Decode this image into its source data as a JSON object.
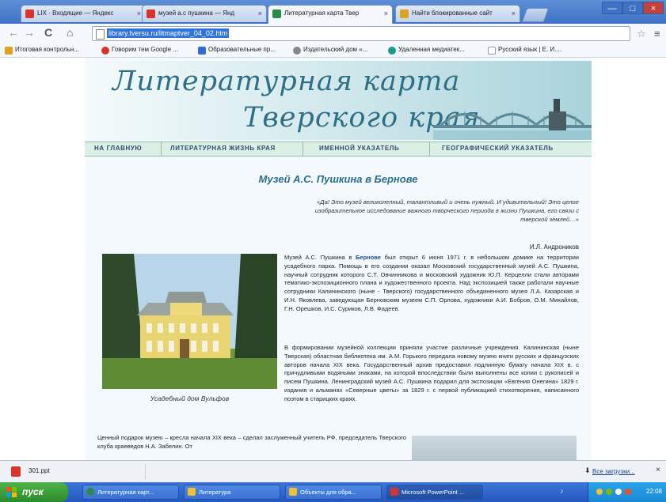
{
  "browser": {
    "tabs": [
      {
        "label": "LIX · Входящие — Яндекс",
        "color": "#d9342b",
        "active": false
      },
      {
        "label": "музей а.с пушкина — Янд",
        "color": "#d9342b",
        "active": false
      },
      {
        "label": "Литературная карта Твер",
        "color": "#2c8a4a",
        "active": true
      },
      {
        "label": "Найти блокированные сайт",
        "color": "#e0a020",
        "active": false
      }
    ],
    "close_glyph": "×",
    "window_buttons": [
      "—",
      "□",
      "×"
    ],
    "nav": {
      "back": "←",
      "forward": "→",
      "reload": "C",
      "home": "⌂"
    },
    "url": "library.tversu.ru/litmaptver_04_02.htm",
    "bookmarks": [
      {
        "label": "Итоговая контрольн...",
        "color": "#e0a020"
      },
      {
        "label": "Говорим тем Google ...",
        "color": "#d9342b"
      },
      {
        "label": "Образовательные пр...",
        "color": "#2f6fd1"
      },
      {
        "label": "Издательский дом «...",
        "color": "#888888"
      },
      {
        "label": "Удаленная медиатек...",
        "color": "#1a9a8a"
      },
      {
        "label": "Русский язык | Е. И....",
        "color": "#ffffff"
      }
    ]
  },
  "site": {
    "banner_line1": "Литературная карта",
    "banner_line2": "Тверского края",
    "menu": [
      "НА ГЛАВНУЮ",
      "ЛИТЕРАТУРНАЯ ЖИЗНЬ КРАЯ",
      "ИМЕННОЙ УКАЗАТЕЛЬ",
      "ГЕОГРАФИЧЕСКИЙ УКАЗАТЕЛЬ"
    ],
    "title": "Музей А.С. Пушкина в Бернове",
    "epigraph": "«Да! Это музей великолепный, талантливый и очень нужный. И удивительный! Это целое изобразительное исследование важного творческого периода в жизни Пушкина, его связи с тверской землей…»",
    "epigraph_author": "И.Л. Андроников",
    "photo_caption": "Усадебный дом Вульфов",
    "para1_start": "Музей А.С. Пушкина в ",
    "para1_link": "Бернове",
    "para1_rest": " был открыт 6 июня 1971 г. в небольшом домике на территории усадебного парка. Помощь в его создании оказал Московский государственный музей А.С. Пушкина, научный сотрудник которого С.Т. Овчинникова и московский художник Ю.П. Керцелли стали авторами тематико-экспозиционного плана и художественного проекта. Над экспозицией также работали научные сотрудники Калининского (ныне - Тверского) государственного объединенного музея Л.А. Казарская и И.Н. Яковлева, заведующая Берновским музеем С.П. Орлова, художники А.И. Бобров, О.М. Михайлов, Г.Н. Орешков, И.С. Суриков, Л.В. Фадеев.",
    "para2": "В формировании музейной коллекции приняли участие различные учреждения. Калининская (ныне Тверская) областная библиотека им. А.М. Горького передала новому музею книги русских и французских авторов начала XIX века. Государственный архив предоставил подлинную бумагу начала XIX в. с причудливыми водяными знаками, на которой впоследствии были выполнены все копии с рукописей и писем Пушкина. Ленинградский музей А.С. Пушкина подарил для экспозиции «Евгения Онегина» 1829 г. издания и альманах «Северные цветы» за 1829 г. с первой публикацией стихотворения, написанного поэтом в старицких краях.",
    "para3": "Ценный подарок музею – кресла начала XIX века – сделал заслуженный учитель РФ, председатель Тверского клуба краеведов Н.А. Забелин. От"
  },
  "download_shelf": {
    "item": "301.ppt",
    "all_downloads": "Все загрузки...",
    "download_glyph": "⬇",
    "close_glyph": "×"
  },
  "taskbar": {
    "start": "пуск",
    "tasks": [
      {
        "label": "Литературная карт...",
        "color": "#2c8a4a",
        "active": false
      },
      {
        "label": "Литература",
        "color": "#f0c030",
        "active": false
      },
      {
        "label": "Объекты для обра...",
        "color": "#f0c030",
        "active": false
      },
      {
        "label": "Microsoft PowerPoint ...",
        "color": "#d9342b",
        "active": true
      }
    ],
    "tray_volume": "♪",
    "clock": "22:08"
  }
}
